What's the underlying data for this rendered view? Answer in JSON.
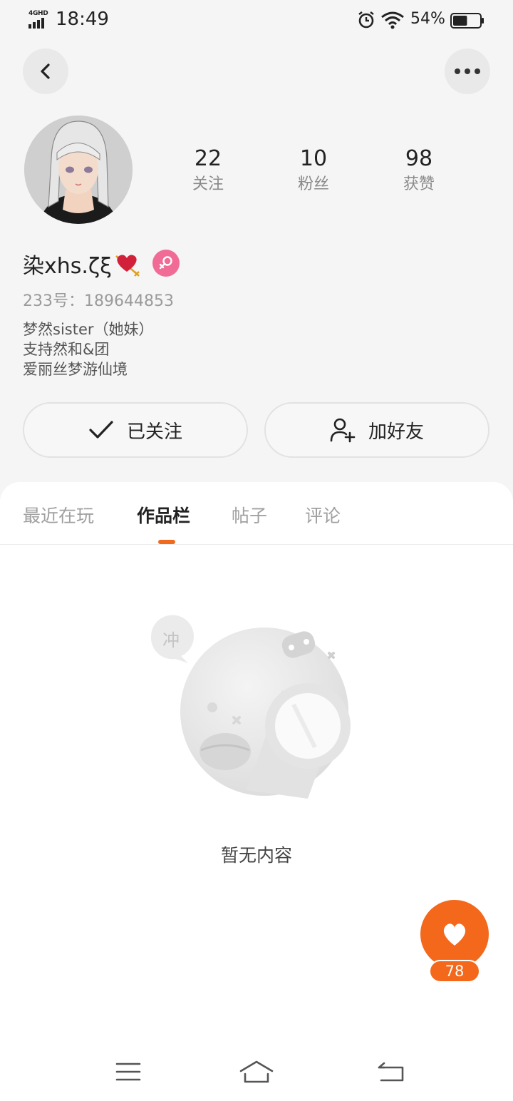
{
  "status_bar": {
    "network": "4GHD",
    "time": "18:49",
    "battery_percent": "54%",
    "battery_level": 0.54,
    "icons": [
      "signal-icon",
      "alarm-icon",
      "wifi-icon",
      "battery-icon"
    ]
  },
  "header": {
    "back_icon": "chevron-left-icon",
    "more_icon": "more-dots-icon"
  },
  "profile": {
    "stats": [
      {
        "value": "22",
        "label": "关注"
      },
      {
        "value": "10",
        "label": "粉丝"
      },
      {
        "value": "98",
        "label": "获赞"
      }
    ],
    "username": "染xhs.ζξ",
    "gender": "female",
    "uid": "233号：189644853",
    "bio": [
      "梦然sister（她妹）",
      "支持然和&团",
      "爱丽丝梦游仙境"
    ]
  },
  "actions": {
    "follow_label": "已关注",
    "add_friend_label": "加好友"
  },
  "tabs": [
    {
      "label": "最近在玩",
      "active": false
    },
    {
      "label": "作品栏",
      "active": true
    },
    {
      "label": "帖子",
      "active": false
    },
    {
      "label": "评论",
      "active": false
    }
  ],
  "empty_state": {
    "bubble_text": "冲",
    "message": "暂无内容"
  },
  "like_fab": {
    "count": "78"
  },
  "colors": {
    "accent": "#f4681c",
    "female_badge": "#f06b96",
    "background": "#f5f5f5"
  }
}
